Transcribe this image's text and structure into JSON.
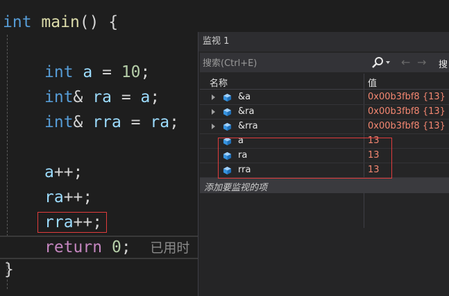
{
  "editor": {
    "lines": {
      "main": {
        "kw": "int",
        "fn": "main",
        "rest": "() {"
      },
      "a_decl": {
        "kw": "int",
        "id": "a",
        "op": " = ",
        "num": "10",
        "end": ";"
      },
      "ra_decl": {
        "kw": "int",
        "amp": "&",
        "id": "ra",
        "op": " = ",
        "rhs": "a",
        "end": ";"
      },
      "rra_decl": {
        "kw": "int",
        "amp": "&",
        "id": "rra",
        "op": " = ",
        "rhs": "ra",
        "end": ";"
      },
      "a_inc": {
        "id": "a",
        "op": "++;"
      },
      "ra_inc": {
        "id": "ra",
        "op": "++;"
      },
      "rra_inc": {
        "id": "rra",
        "op": "++;"
      },
      "ret": {
        "kw": "return",
        "num": "0",
        "end": ";",
        "hint": "已用时"
      },
      "close": "}"
    }
  },
  "watch": {
    "title": "监视 1",
    "search": {
      "placeholder": "搜索(Ctrl+E)",
      "depth_label": "搜"
    },
    "columns": {
      "name": "名称",
      "value": "值"
    },
    "rows": [
      {
        "name": "&a",
        "value": "0x00b3fbf8 {13}"
      },
      {
        "name": "&ra",
        "value": "0x00b3fbf8 {13}"
      },
      {
        "name": "&rra",
        "value": "0x00b3fbf8 {13}"
      },
      {
        "name": "a",
        "value": "13"
      },
      {
        "name": "ra",
        "value": "13"
      },
      {
        "name": "rra",
        "value": "13"
      }
    ],
    "add_item": "添加要监视的项"
  },
  "colors": {
    "highlight_border": "#e03c3c",
    "value_text": "#f48771",
    "keyword": "#569cd6"
  }
}
